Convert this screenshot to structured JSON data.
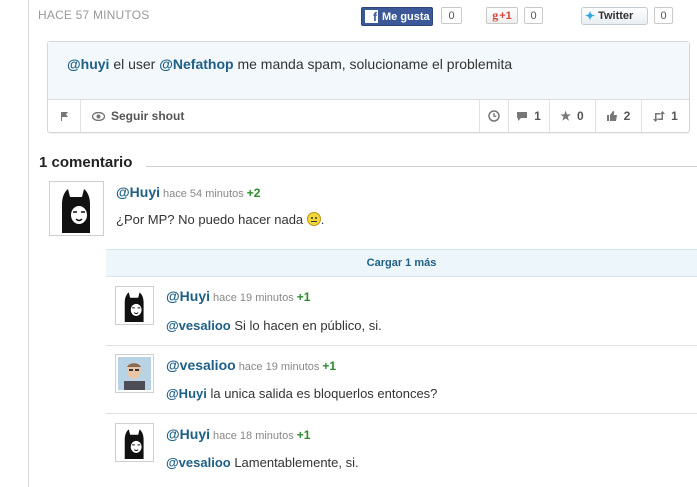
{
  "shout": {
    "time": "HACE 57 MINUTOS",
    "share": {
      "facebook_label": "Me gusta",
      "facebook_count": "0",
      "gplus_label": "+1",
      "gplus_count": "0",
      "twitter_label": "Twitter",
      "twitter_count": "0"
    },
    "text": {
      "mention1": "@huyi",
      "part1": " el user ",
      "mention2": "@Nefathop",
      "part2": " me manda spam, solucioname el problemita"
    },
    "actions": {
      "follow_label": "Seguir shout",
      "comments": "1",
      "favorites": "0",
      "likes": "2",
      "reshouts": "1"
    }
  },
  "comments": {
    "title": "1 comentario",
    "load_more": "Cargar 1 más",
    "main": {
      "user": "@Huyi",
      "ago": "hace 54 minutos",
      "votes": "+2",
      "text": "¿Por MP? No puedo hacer nada "
    },
    "replies": [
      {
        "user": "@Huyi",
        "ago": "hace 19 minutos",
        "votes": "+1",
        "mention": "@vesalioo",
        "text": " Si lo hacen en público, si."
      },
      {
        "user": "@vesalioo",
        "ago": "hace 19 minutos",
        "votes": "+1",
        "mention": "@Huyi",
        "text": " la unica salida es bloquerlos entonces?"
      },
      {
        "user": "@Huyi",
        "ago": "hace 18 minutos",
        "votes": "+1",
        "mention": "@vesalioo",
        "text": " Lamentablemente, si."
      }
    ]
  },
  "colors": {
    "link": "#1e5f86",
    "vote": "#2c8a2c",
    "facebook": "#3b5998"
  },
  "icons": [
    "flag-icon",
    "eye-icon",
    "clock-icon",
    "comment-icon",
    "star-icon",
    "thumbs-up-icon",
    "retweet-icon",
    "smiley-emoticon",
    "facebook-icon",
    "twitter-bird-icon"
  ]
}
